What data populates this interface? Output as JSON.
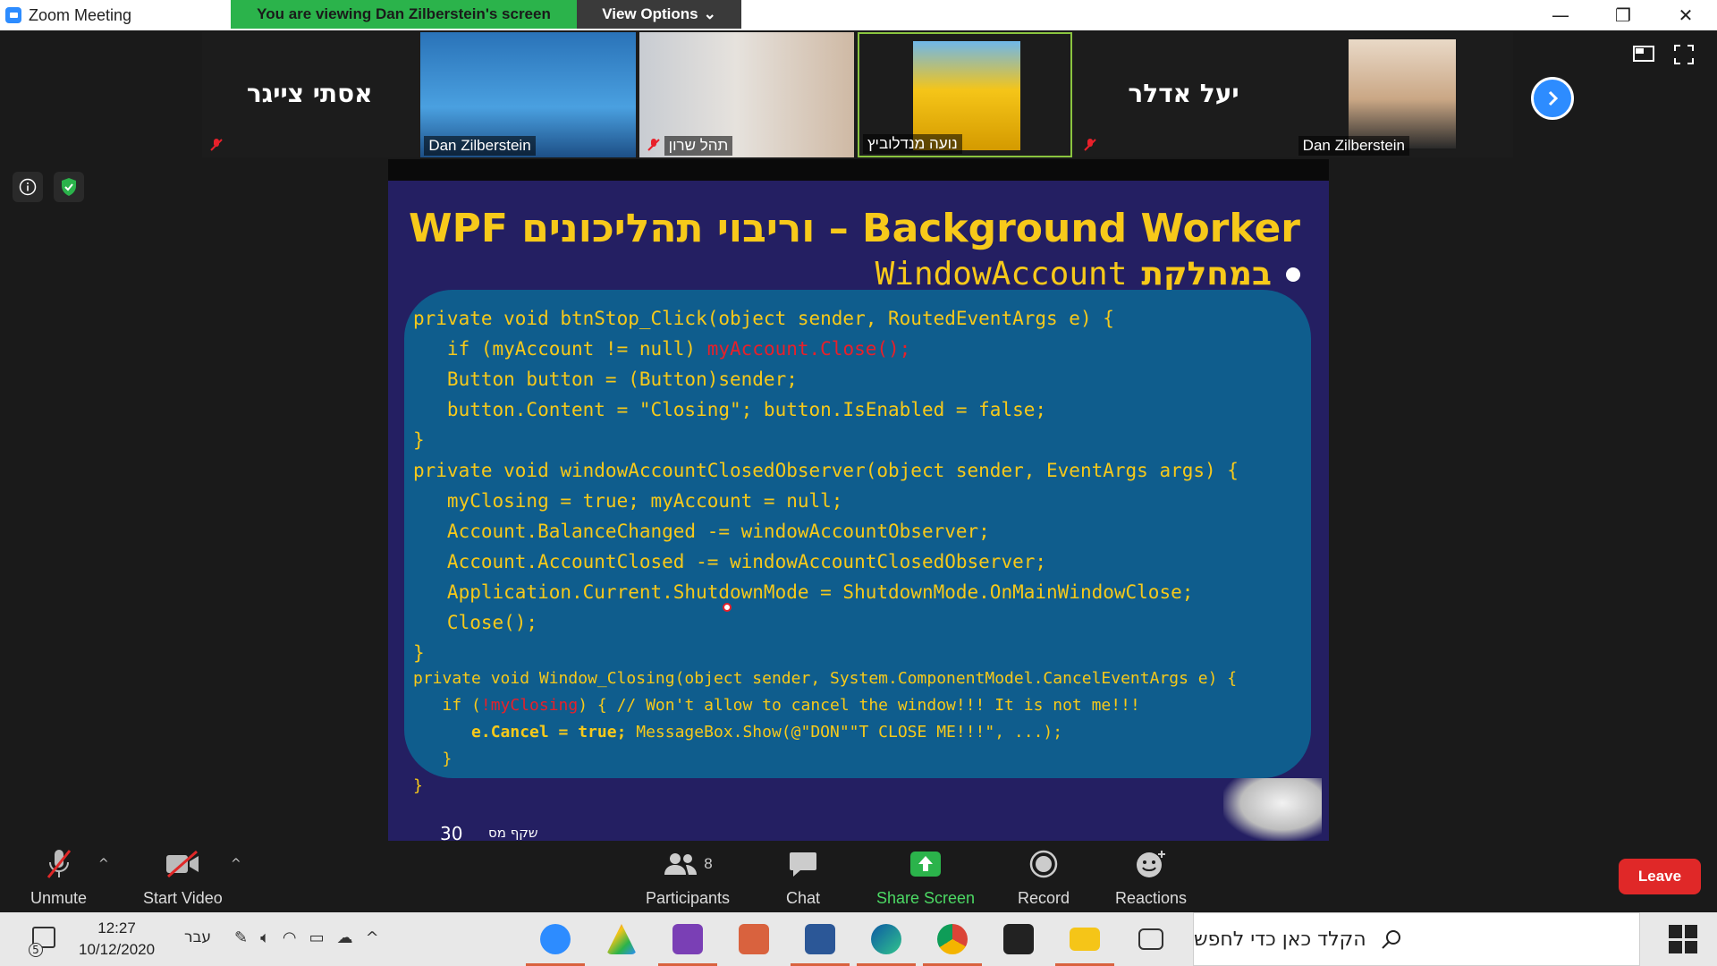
{
  "window": {
    "title": "Zoom Meeting",
    "viewing_banner": "You are viewing Dan Zilberstein's screen",
    "view_options": "View Options",
    "controls": [
      "—",
      "❐",
      "✕"
    ]
  },
  "participants_strip": [
    {
      "name": "אסתי צייגר",
      "video": false,
      "muted": true
    },
    {
      "name": "Dan Zilberstein",
      "video": true,
      "muted": false
    },
    {
      "name": "תהל שרון",
      "video": true,
      "muted": true
    },
    {
      "name": "נועה מנדלוביץ",
      "video": true,
      "muted": false,
      "active": true
    },
    {
      "name": "יעל אדלר",
      "video": false,
      "muted": true
    },
    {
      "name": "Dan Zilberstein",
      "video": true,
      "muted": false
    }
  ],
  "slide": {
    "title": "WPF וריבוי תהליכונים – Background Worker",
    "subtitle_code": "WindowAccount",
    "subtitle_text": "במחלקת",
    "code": {
      "l1": "private void btnStop_Click(object sender, RoutedEventArgs e) {",
      "l2a": "   if (myAccount != null) ",
      "l2b": "myAccount.Close();",
      "l3": "   Button button = (Button)sender;",
      "l4": "   button.Content = \"Closing\"; button.IsEnabled = false;",
      "l5": "}",
      "l6": "private void windowAccountClosedObserver(object sender, EventArgs args) {",
      "l7": "   myClosing = true; myAccount = null;",
      "l8": "   Account.BalanceChanged -= windowAccountObserver;",
      "l9": "   Account.AccountClosed -= windowAccountClosedObserver;",
      "l10": "   Application.Current.ShutdownMode = ShutdownMode.OnMainWindowClose;",
      "l11": "   Close();",
      "l12": "}",
      "l13": "private void Window_Closing(object sender, System.ComponentModel.CancelEventArgs e) {",
      "l14a": "   if (",
      "l14b": "!myClosing",
      "l14c": ") { // Won't allow to cancel the window!!! It is not me!!!",
      "l15a": "      e.Cancel = true; ",
      "l15b": "MessageBox.Show(@\"DON\"\"T CLOSE ME!!!\", ...);",
      "l16": "   }",
      "l17": "}"
    },
    "page_number": "30",
    "footer_text": "שקף מס"
  },
  "toolbar": {
    "unmute": "Unmute",
    "start_video": "Start Video",
    "participants": "Participants",
    "participants_count": "8",
    "chat": "Chat",
    "share_screen": "Share Screen",
    "record": "Record",
    "reactions": "Reactions",
    "leave": "Leave"
  },
  "taskbar": {
    "notification_count": "5",
    "time": "12:27",
    "date": "10/12/2020",
    "language": "עבר",
    "search_placeholder": "הקלד כאן כדי לחפש"
  },
  "colors": {
    "zoom_blue": "#2d8cff",
    "banner_green": "#2bb34b",
    "slide_bg": "#241f62",
    "code_panel": "#0f5d8d",
    "slide_yellow": "#f7c91a",
    "code_red": "#e8202a",
    "leave_red": "#e02828"
  }
}
